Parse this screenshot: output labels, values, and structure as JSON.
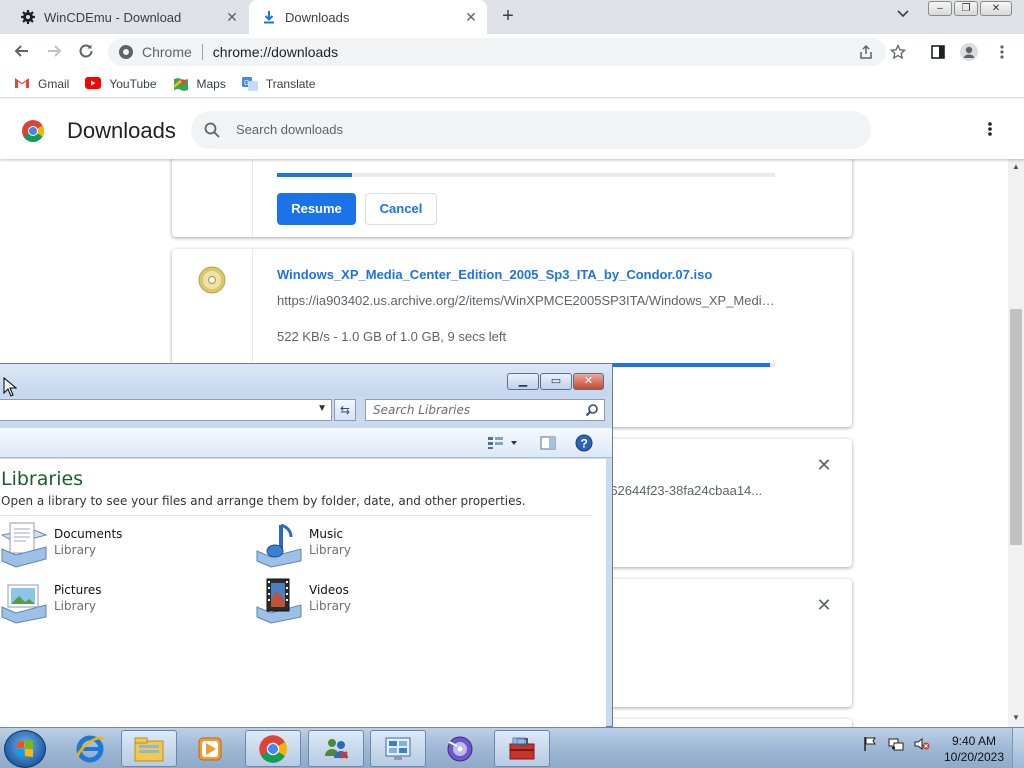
{
  "browser": {
    "tabs": [
      {
        "title": "WinCDEmu - Download",
        "icon": "gear-icon",
        "active": false
      },
      {
        "title": "Downloads",
        "icon": "download-icon",
        "active": true
      }
    ],
    "omnibox": {
      "chip": "Chrome",
      "url": "chrome://downloads"
    },
    "bookmarks": [
      {
        "label": "Gmail",
        "icon": "gmail-icon"
      },
      {
        "label": "YouTube",
        "icon": "youtube-icon"
      },
      {
        "label": "Maps",
        "icon": "maps-icon"
      },
      {
        "label": "Translate",
        "icon": "translate-icon"
      }
    ]
  },
  "downloads": {
    "title": "Downloads",
    "search_placeholder": "Search downloads",
    "items": [
      {
        "progress_percent": 15,
        "resume_label": "Resume",
        "cancel_label": "Cancel"
      },
      {
        "filename": "Windows_XP_Media_Center_Edition_2005_Sp3_ITA_by_Condor.07.iso",
        "url": "https://ia903402.us.archive.org/2/items/WinXPMCE2005SP3ITA/Windows_XP_Media_Center_Edition_2005_Sp3_ITA_by_Condor.07.iso",
        "status": "522 KB/s - 1.0 GB of 1.0 GB, 9 secs left",
        "progress_percent": 99
      },
      {
        "url_fragment": "-62644f23-38fa24cbaa14..."
      },
      {}
    ]
  },
  "explorer": {
    "search_placeholder": "Search Libraries",
    "heading": "Libraries",
    "subheading": "Open a library to see your files and arrange them by folder, date, and other properties.",
    "libraries": [
      {
        "name": "Documents",
        "type": "Library",
        "icon": "documents-library-icon"
      },
      {
        "name": "Music",
        "type": "Library",
        "icon": "music-library-icon"
      },
      {
        "name": "Pictures",
        "type": "Library",
        "icon": "pictures-library-icon"
      },
      {
        "name": "Videos",
        "type": "Library",
        "icon": "videos-library-icon"
      }
    ]
  },
  "taskbar": {
    "apps": [
      "internet-explorer-icon",
      "windows-explorer-icon",
      "media-player-icon",
      "chrome-icon",
      "network-users-icon",
      "control-panel-icon",
      "disc-burn-icon",
      "toolbox-icon"
    ],
    "clock": {
      "time": "9:40 AM",
      "date": "10/20/2023"
    }
  },
  "colors": {
    "accent": "#1a73e8",
    "libraries_heading": "#1e5b2f"
  }
}
